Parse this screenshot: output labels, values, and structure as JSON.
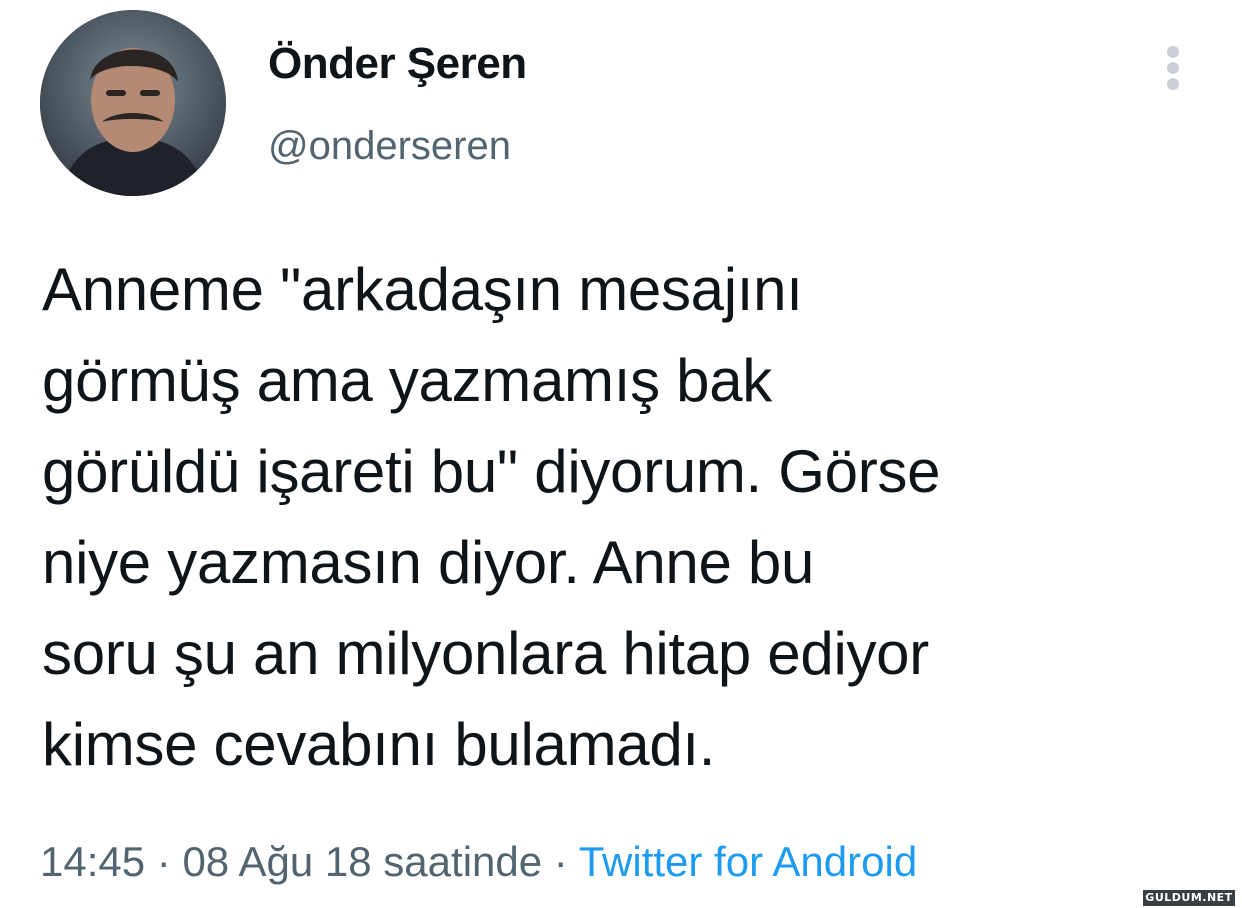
{
  "tweet": {
    "author": {
      "display_name": "Önder Şeren",
      "handle": "@onderseren",
      "avatar_icon": "profile-photo"
    },
    "more_icon": "more-vertical-icon",
    "text": "Anneme \"arkadaşın mesajını\ngörmüş ama yazmamış bak\ngörüldü işareti bu\" diyorum. Görse\nniye yazmasın diyor. Anne bu\nsoru şu an milyonlara hitap ediyor\nkimse cevabını bulamadı.",
    "time": "14:45",
    "date": "08 Ağu 18 saatinde",
    "separator": "·",
    "source": "Twitter for Android"
  },
  "watermark": "GULDUM.NET",
  "colors": {
    "text": "#0f1419",
    "muted": "#536471",
    "link": "#1d9bf0",
    "background": "#ffffff"
  }
}
